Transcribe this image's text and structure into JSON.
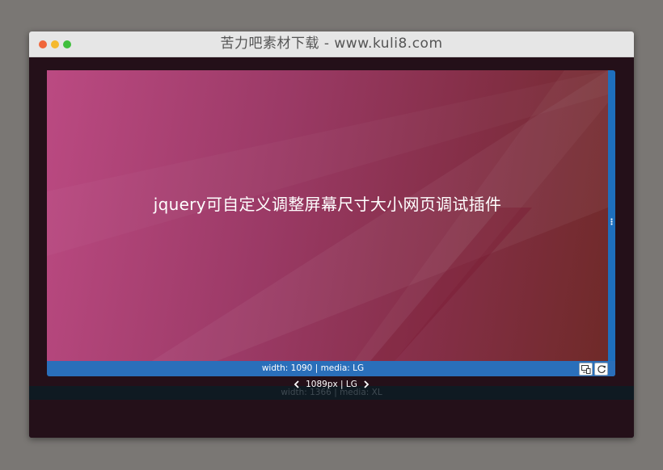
{
  "window": {
    "title": "苦力吧素材下载 - www.kuli8.com"
  },
  "viewport": {
    "headline": "jquery可自定义调整屏幕尺寸大小网页调试插件"
  },
  "statusbar": {
    "text": "width: 1090 | media: LG"
  },
  "size_nav": {
    "label": "1089px | LG"
  },
  "breakpoint": {
    "text": "width: 1366 | media: XL"
  },
  "icons": {
    "prev": "chevron-left-icon",
    "next": "chevron-right-icon",
    "devices": "devices-icon",
    "rotate": "rotate-icon"
  },
  "colors": {
    "accent": "#2a6fba",
    "window_bg": "#251219",
    "gradient_start": "#bb4a82",
    "gradient_end": "#6f2a28"
  }
}
